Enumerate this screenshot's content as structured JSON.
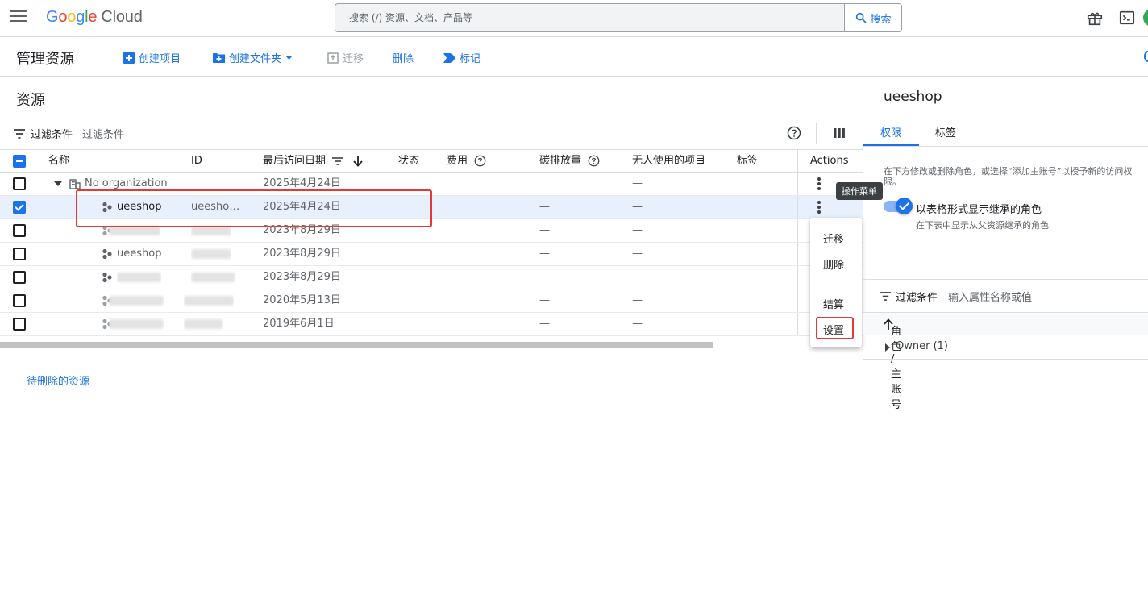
{
  "header": {
    "logo_google": [
      "G",
      "o",
      "o",
      "g",
      "l",
      "e"
    ],
    "logo_cloud": "Cloud",
    "search_placeholder": "搜索 (/) 资源、文档、产品等",
    "search_button": "搜索"
  },
  "toolbar": {
    "page_title": "管理资源",
    "create_project": "创建项目",
    "create_folder": "创建文件夹",
    "migrate": "迁移",
    "delete": "删除",
    "tag": "标记"
  },
  "resources": {
    "title": "资源",
    "filter_label": "过滤条件",
    "filter_placeholder": "过滤条件",
    "columns": {
      "name": "名称",
      "id": "ID",
      "last_access": "最后访问日期",
      "status": "状态",
      "cost": "费用",
      "carbon": "碳排放量",
      "unattended": "无人使用的项目",
      "labels": "标签",
      "actions": "Actions"
    },
    "org_row": {
      "name": "No organization",
      "date": "2025年4月24日",
      "unattended": "—"
    },
    "rows": [
      {
        "name": "ueeshop",
        "id": "ueesho…",
        "date": "2025年4月24日",
        "carbon": "—",
        "unattended": "—",
        "checked": true
      },
      {
        "name": "",
        "id": "",
        "date": "2023年8月29日",
        "carbon": "—",
        "unattended": "—",
        "checked": false
      },
      {
        "name": "ueeshop",
        "id": "",
        "date": "2023年8月29日",
        "carbon": "—",
        "unattended": "—",
        "checked": false
      },
      {
        "name": "",
        "id": "",
        "date": "2023年8月29日",
        "carbon": "—",
        "unattended": "—",
        "checked": false
      },
      {
        "name": "",
        "id": "",
        "date": "2020年5月13日",
        "carbon": "—",
        "unattended": "—",
        "checked": false
      },
      {
        "name": "",
        "id": "",
        "date": "2019年6月1日",
        "carbon": "—",
        "unattended": "—",
        "checked": false
      }
    ],
    "pending_delete_link": "待删除的资源"
  },
  "action_menu": {
    "tooltip": "操作菜单",
    "items": [
      "迁移",
      "删除",
      "结算",
      "设置"
    ]
  },
  "right_panel": {
    "title": "ueeshop",
    "tabs": [
      "权限",
      "标签"
    ],
    "description": "在下方修改或删除角色，或选择“添加主账号”以授予新的访问权限。",
    "toggle_label": "以表格形式显示继承的角色",
    "toggle_sub": "在下表中显示从父资源继承的角色",
    "filter_label": "过滤条件",
    "filter_placeholder": "输入属性名称或值",
    "table_header": "角色 / 主账号",
    "owner_row": "Owner (1)"
  }
}
